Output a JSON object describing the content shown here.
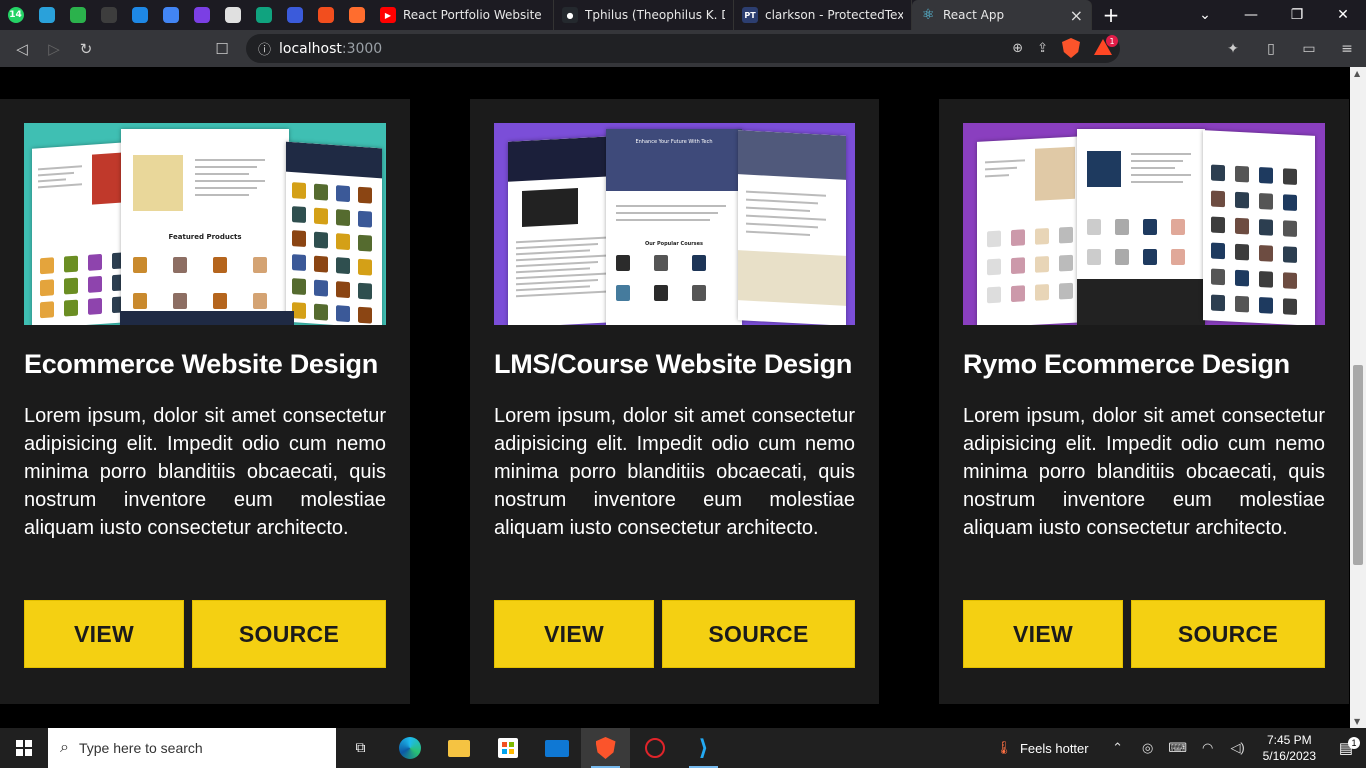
{
  "browser": {
    "pinned_tabs": [
      {
        "icon": "whatsapp-icon",
        "color": "#25d366",
        "badge": "14"
      },
      {
        "icon": "telegram-icon",
        "color": "#2aa1da"
      },
      {
        "icon": "feedly-icon",
        "color": "#2bb24c"
      },
      {
        "icon": "app-icon",
        "color": "#3d3d3d"
      },
      {
        "icon": "play-icon",
        "color": "#1e88e5"
      },
      {
        "icon": "docs-icon",
        "color": "#4285f4"
      },
      {
        "icon": "u-app-icon",
        "color": "#7b3fe4"
      },
      {
        "icon": "newspaper-icon",
        "color": "#e0e0e0"
      },
      {
        "icon": "chatgpt-icon",
        "color": "#10a37f"
      },
      {
        "icon": "analytics-icon",
        "color": "#3b5bdb"
      },
      {
        "icon": "figma-icon",
        "color": "#f24e1e"
      },
      {
        "icon": "b-app-icon",
        "color": "#ff6d2e"
      }
    ],
    "tabs": [
      {
        "label": "React Portfolio Website Tut",
        "icon": "youtube-icon",
        "color": "#ff0000",
        "fav_text": "▶"
      },
      {
        "label": "Tphilus (Theophilus K. Dadz",
        "icon": "github-icon",
        "color": "#24292e",
        "fav_text": "●"
      },
      {
        "label": "clarkson - ProtectedText",
        "icon": "protectedtext-icon",
        "color": "#2c3e70",
        "fav_text": "PT"
      },
      {
        "label": "React App",
        "icon": "react-icon",
        "color": "#35363a",
        "fav_text": "⚛",
        "active": true
      }
    ],
    "new_tab": "+",
    "close": "×",
    "url_host": "localhost",
    "url_port": ":3000",
    "rewards_badge": "1"
  },
  "projects": [
    {
      "title": "Ecommerce Website Design",
      "description": "Lorem ipsum, dolor sit amet consectetur adipisicing elit. Impedit odio cum nemo minima porro blanditiis obcaecati, quis nostrum inventore eum molestiae aliquam iusto consectetur architecto.",
      "view_label": "VIEW",
      "source_label": "SOURCE",
      "bg": "#3fbfb3"
    },
    {
      "title": "LMS/Course Website Design",
      "description": "Lorem ipsum, dolor sit amet consectetur adipisicing elit. Impedit odio cum nemo minima porro blanditiis obcaecati, quis nostrum inventore eum molestiae aliquam iusto consectetur architecto.",
      "view_label": "VIEW",
      "source_label": "SOURCE",
      "bg": "#7b4ed8"
    },
    {
      "title": "Rymo Ecommerce Design",
      "description": "Lorem ipsum, dolor sit amet consectetur adipisicing elit. Impedit odio cum nemo minima porro blanditiis obcaecati, quis nostrum inventore eum molestiae aliquam iusto consectetur architecto.",
      "view_label": "VIEW",
      "source_label": "SOURCE",
      "bg": "#8a3fbf"
    }
  ],
  "mock_text": {
    "featured_products": "Featured Products",
    "enhance": "Enhance Your Future With Tech",
    "popular_courses": "Our Popular Courses"
  },
  "taskbar": {
    "search_placeholder": "Type here to search",
    "weather": "Feels hotter",
    "time": "7:45 PM",
    "date": "5/16/2023",
    "notification_count": "1"
  }
}
